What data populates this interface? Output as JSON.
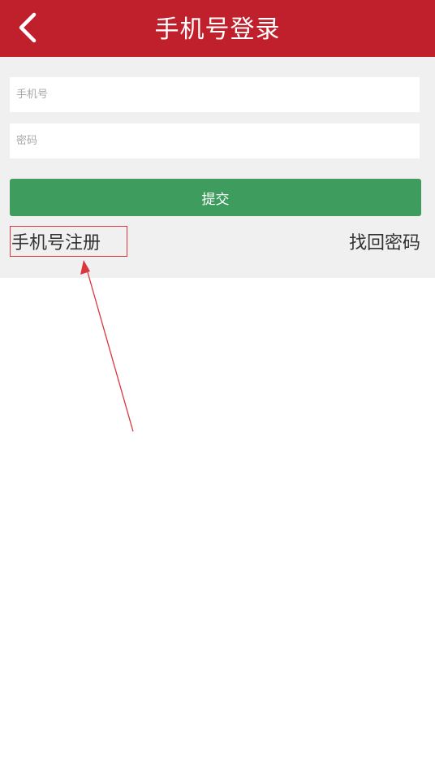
{
  "header": {
    "back_icon": "chevron-left-icon",
    "title": "手机号登录",
    "background": "#c0202c"
  },
  "form": {
    "phone_placeholder": "手机号",
    "password_placeholder": "密码",
    "submit_label": "提交",
    "submit_color": "#3f9c5f"
  },
  "links": {
    "register_label": "手机号注册",
    "forgot_label": "找回密码"
  },
  "annotation": {
    "highlight_color": "#d9363e"
  }
}
